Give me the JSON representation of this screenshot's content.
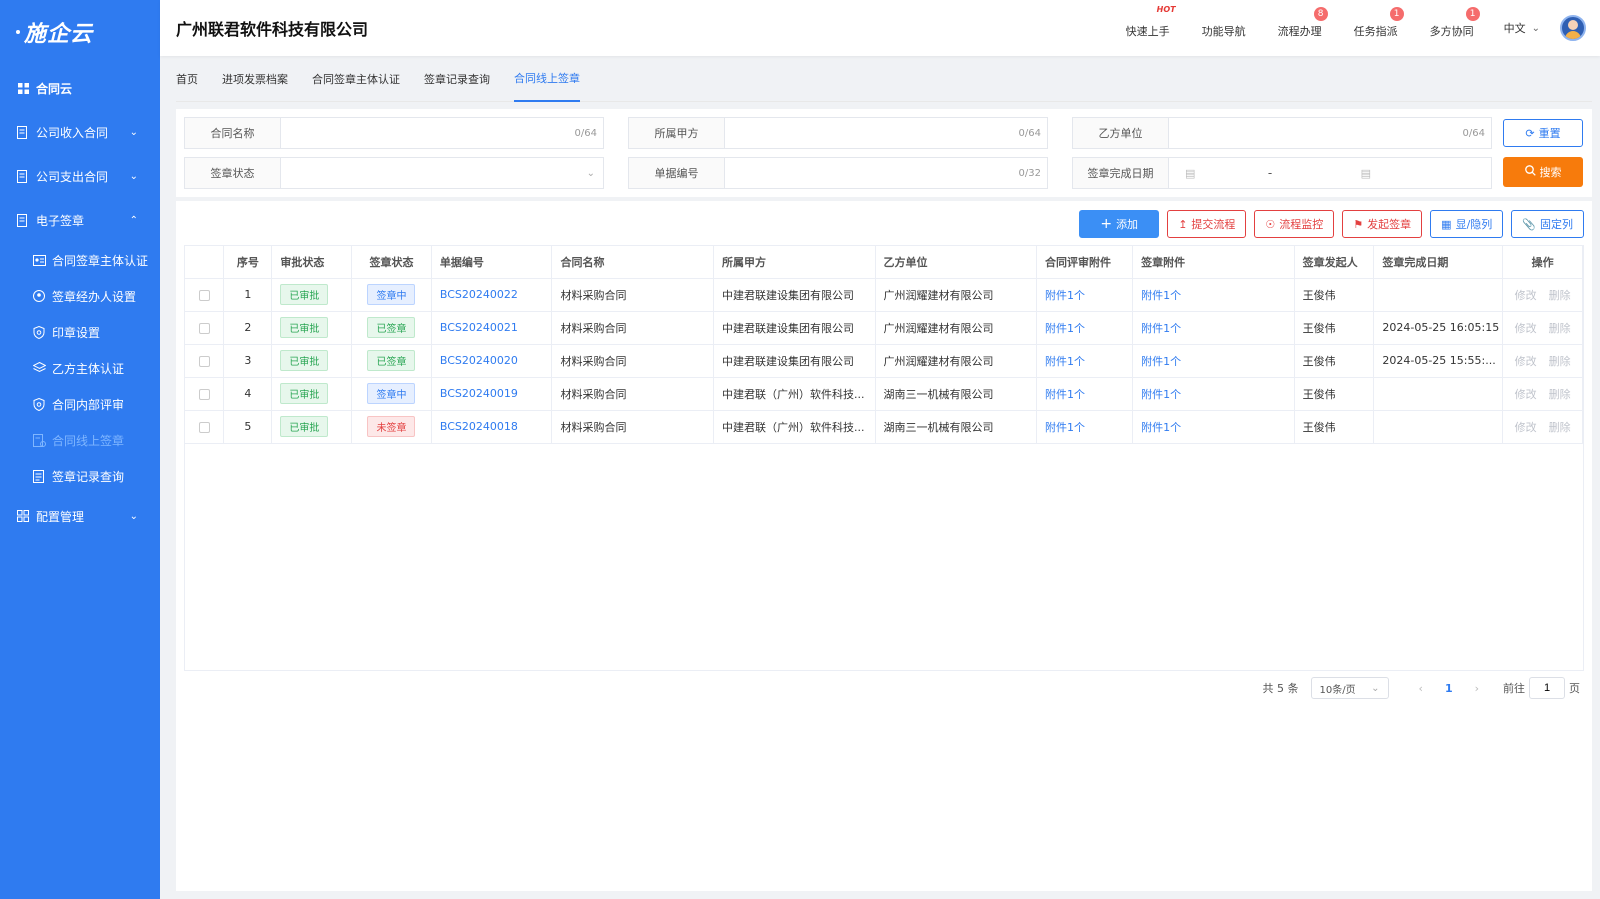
{
  "sidebar": {
    "logo": "施企云",
    "items": [
      {
        "label": "合同云",
        "icon": "grid-icon"
      },
      {
        "label": "公司收入合同",
        "icon": "document-icon"
      },
      {
        "label": "公司支出合同",
        "icon": "document-icon"
      },
      {
        "label": "电子签章",
        "icon": "document-icon"
      },
      {
        "label": "配置管理",
        "icon": "settings-grid-icon"
      }
    ],
    "sub_items": [
      {
        "label": "合同签章主体认证",
        "icon": "id-card-icon"
      },
      {
        "label": "签章经办人设置",
        "icon": "person-circle-icon"
      },
      {
        "label": "印章设置",
        "icon": "shield-icon"
      },
      {
        "label": "乙方主体认证",
        "icon": "layers-icon"
      },
      {
        "label": "合同内部评审",
        "icon": "shield-icon"
      },
      {
        "label": "合同线上签章",
        "icon": "sign-doc-icon"
      },
      {
        "label": "签章记录查询",
        "icon": "list-icon"
      }
    ]
  },
  "header": {
    "company": "广州联君软件科技有限公司",
    "quick_start": "快速上手",
    "hot": "HOT",
    "function_nav": "功能导航",
    "process": "流程办理",
    "process_badge": "8",
    "task": "任务指派",
    "task_badge": "1",
    "collab": "多方协同",
    "collab_badge": "1",
    "language": "中文"
  },
  "tabs": [
    "首页",
    "进项发票档案",
    "合同签章主体认证",
    "签章记录查询",
    "合同线上签章"
  ],
  "search": {
    "contract_name": {
      "label": "合同名称",
      "count": "0/64"
    },
    "party_a": {
      "label": "所属甲方",
      "count": "0/64"
    },
    "party_b": {
      "label": "乙方单位",
      "count": "0/64"
    },
    "sign_status": {
      "label": "签章状态"
    },
    "doc_no": {
      "label": "单据编号",
      "count": "0/32"
    },
    "done_date": {
      "label": "签章完成日期",
      "separator": "-"
    },
    "reset": "重置",
    "search": "搜索"
  },
  "toolbar": {
    "add": "添加",
    "submit_flow": "提交流程",
    "flow_monitor": "流程监控",
    "start_sign": "发起签章",
    "show_hide": "显/隐列",
    "fix_col": "固定列"
  },
  "table": {
    "headers": [
      "序号",
      "审批状态",
      "签章状态",
      "单据编号",
      "合同名称",
      "所属甲方",
      "乙方单位",
      "合同评审附件",
      "签章附件",
      "签章发起人",
      "签章完成日期",
      "操作"
    ],
    "edit_label": "修改",
    "delete_label": "删除",
    "rows": [
      {
        "no": "1",
        "approval": "已审批",
        "sign": "签章中",
        "doc": "BCS20240022",
        "name": "材料采购合同",
        "party_a": "中建君联建设集团有限公司",
        "party_b": "广州润耀建材有限公司",
        "review_att": "附件1个",
        "sign_att": "附件1个",
        "initiator": "王俊伟",
        "done": ""
      },
      {
        "no": "2",
        "approval": "已审批",
        "sign": "已签章",
        "doc": "BCS20240021",
        "name": "材料采购合同",
        "party_a": "中建君联建设集团有限公司",
        "party_b": "广州润耀建材有限公司",
        "review_att": "附件1个",
        "sign_att": "附件1个",
        "initiator": "王俊伟",
        "done": "2024-05-25 16:05:15"
      },
      {
        "no": "3",
        "approval": "已审批",
        "sign": "已签章",
        "doc": "BCS20240020",
        "name": "材料采购合同",
        "party_a": "中建君联建设集团有限公司",
        "party_b": "广州润耀建材有限公司",
        "review_att": "附件1个",
        "sign_att": "附件1个",
        "initiator": "王俊伟",
        "done": "2024-05-25 15:55:..."
      },
      {
        "no": "4",
        "approval": "已审批",
        "sign": "签章中",
        "doc": "BCS20240019",
        "name": "材料采购合同",
        "party_a": "中建君联（广州）软件科技...",
        "party_b": "湖南三一机械有限公司",
        "review_att": "附件1个",
        "sign_att": "附件1个",
        "initiator": "王俊伟",
        "done": ""
      },
      {
        "no": "5",
        "approval": "已审批",
        "sign": "未签章",
        "doc": "BCS20240018",
        "name": "材料采购合同",
        "party_a": "中建君联（广州）软件科技...",
        "party_b": "湖南三一机械有限公司",
        "review_att": "附件1个",
        "sign_att": "附件1个",
        "initiator": "王俊伟",
        "done": ""
      }
    ]
  },
  "pagination": {
    "total": "共 5 条",
    "page_size": "10条/页",
    "current": "1",
    "goto_prefix": "前往",
    "goto_value": "1",
    "goto_suffix": "页"
  },
  "colors": {
    "sidebar": "#2f7bf0",
    "accent": "#2f7bf0",
    "search_button": "#f77b0c",
    "danger": "#e34040",
    "success": "#2aa654"
  }
}
